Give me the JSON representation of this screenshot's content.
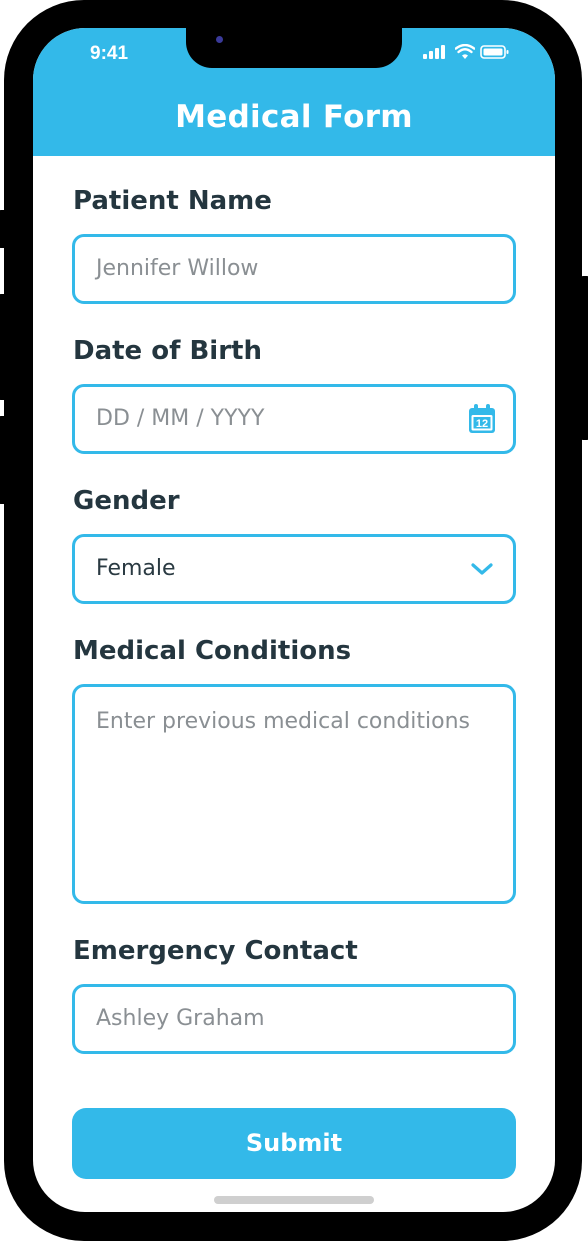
{
  "status_bar": {
    "time": "9:41"
  },
  "header": {
    "title": "Medical Form"
  },
  "form": {
    "patient_name": {
      "label": "Patient Name",
      "value": "Jennifer Willow"
    },
    "date_of_birth": {
      "label": "Date of Birth",
      "placeholder": "DD / MM / YYYY",
      "calendar_day": "12"
    },
    "gender": {
      "label": "Gender",
      "selected": "Female"
    },
    "medical_conditions": {
      "label": "Medical Conditions",
      "placeholder": "Enter previous medical conditions"
    },
    "emergency_contact": {
      "label": "Emergency Contact",
      "value": "Ashley Graham"
    }
  },
  "submit_label": "Submit",
  "colors": {
    "accent": "#33b9e9",
    "text_dark": "#24363f",
    "placeholder": "#8a8f93"
  },
  "icons": [
    "calendar-icon",
    "chevron-down-icon",
    "signal-icon",
    "wifi-icon",
    "battery-icon"
  ]
}
